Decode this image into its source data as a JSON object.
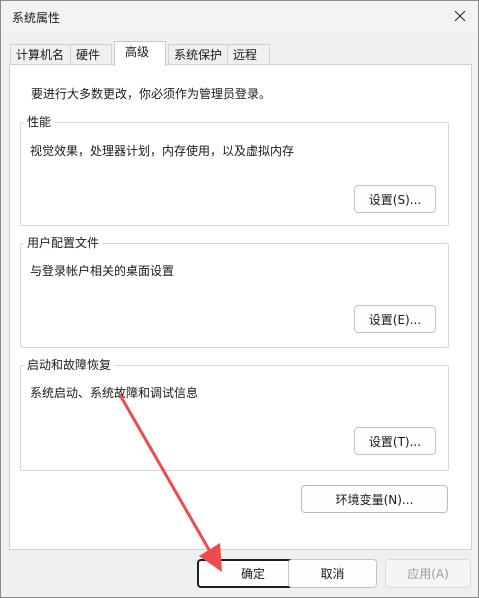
{
  "window": {
    "title": "系统属性"
  },
  "tabs": [
    "计算机名",
    "硬件",
    "高级",
    "系统保护",
    "远程"
  ],
  "intro": "要进行大多数更改，你必须作为管理员登录。",
  "groups": {
    "performance": {
      "title": "性能",
      "description": "视觉效果，处理器计划，内存使用，以及虚拟内存",
      "button": "设置(S)..."
    },
    "user_profile": {
      "title": "用户配置文件",
      "description": "与登录帐户相关的桌面设置",
      "button": "设置(E)..."
    },
    "startup_recovery": {
      "title": "启动和故障恢复",
      "description": "系统启动、系统故障和调试信息",
      "button": "设置(T)..."
    }
  },
  "env_button": "环境变量(N)...",
  "footer": {
    "ok": "确定",
    "cancel": "取消",
    "apply": "应用(A)"
  },
  "colors": {
    "arrow": "#ee4b4b"
  }
}
